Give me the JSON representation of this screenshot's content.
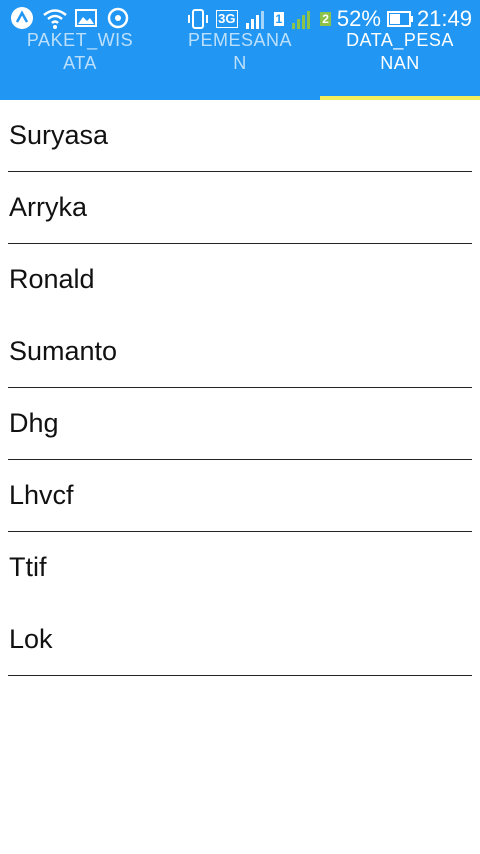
{
  "status_bar": {
    "battery": "52%",
    "time": "21:49",
    "network": "3G",
    "sim1": "1",
    "sim2": "2"
  },
  "tabs": [
    {
      "line1": "PAKET_WIS",
      "line2": "ATA",
      "active": false
    },
    {
      "line1": "PEMESANA",
      "line2": "N",
      "active": false
    },
    {
      "line1": "DATA_PESA",
      "line2": "NAN",
      "active": true
    }
  ],
  "list": {
    "items": [
      {
        "name": "Suryasa",
        "divider": true
      },
      {
        "name": "Arryka",
        "divider": true
      },
      {
        "name": "Ronald",
        "divider": false
      },
      {
        "name": "Sumanto",
        "divider": true
      },
      {
        "name": "Dhg",
        "divider": true
      },
      {
        "name": "Lhvcf",
        "divider": true
      },
      {
        "name": "Ttif",
        "divider": false
      },
      {
        "name": "Lok",
        "divider": true
      }
    ]
  },
  "colors": {
    "app_bar": "#2196f3",
    "tab_indicator": "#f4ef5a",
    "text": "#111111"
  }
}
